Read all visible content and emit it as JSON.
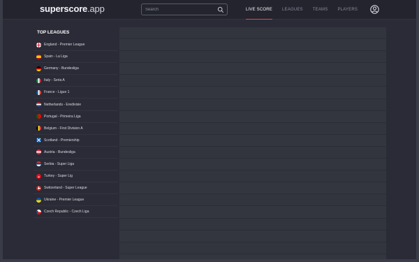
{
  "header": {
    "logo_bold": "superscore",
    "logo_light": ".app",
    "search_placeholder": "Search",
    "nav": [
      {
        "label": "LIVE SCORE",
        "active": true
      },
      {
        "label": "LEAGUES",
        "active": false
      },
      {
        "label": "TEAMS",
        "active": false
      },
      {
        "label": "PLAYERS",
        "active": false
      }
    ],
    "icons": {
      "search": "search-icon",
      "account": "user-circle-icon"
    }
  },
  "sidebar": {
    "title": "TOP LEAGUES",
    "leagues": [
      {
        "label": "England - Premier League",
        "flag": "england"
      },
      {
        "label": "Spain - La Liga",
        "flag": "spain"
      },
      {
        "label": "Germany - Bundesliga",
        "flag": "germany"
      },
      {
        "label": "Italy - Seria A",
        "flag": "italy"
      },
      {
        "label": "France - Ligue 1",
        "flag": "france"
      },
      {
        "label": "Netherlands - Eredivisie",
        "flag": "netherlands"
      },
      {
        "label": "Portugal - Primeira Liga",
        "flag": "portugal"
      },
      {
        "label": "Belgium - First Division A",
        "flag": "belgium"
      },
      {
        "label": "Scotland - Premiership",
        "flag": "scotland"
      },
      {
        "label": "Austria - Bundesliga",
        "flag": "austria"
      },
      {
        "label": "Serbia - Super Liga",
        "flag": "serbia"
      },
      {
        "label": "Turkey - Super Lig",
        "flag": "turkey"
      },
      {
        "label": "Switzerland - Super League",
        "flag": "switzerland"
      },
      {
        "label": "Ukraine - Premier League",
        "flag": "ukraine"
      },
      {
        "label": "Czech Republic - Czech Liga",
        "flag": "czech"
      }
    ]
  },
  "colors": {
    "background": "#2a2b36",
    "header": "#23242e",
    "accent": "#e24a4a",
    "placeholder_panel": "#30323e"
  }
}
